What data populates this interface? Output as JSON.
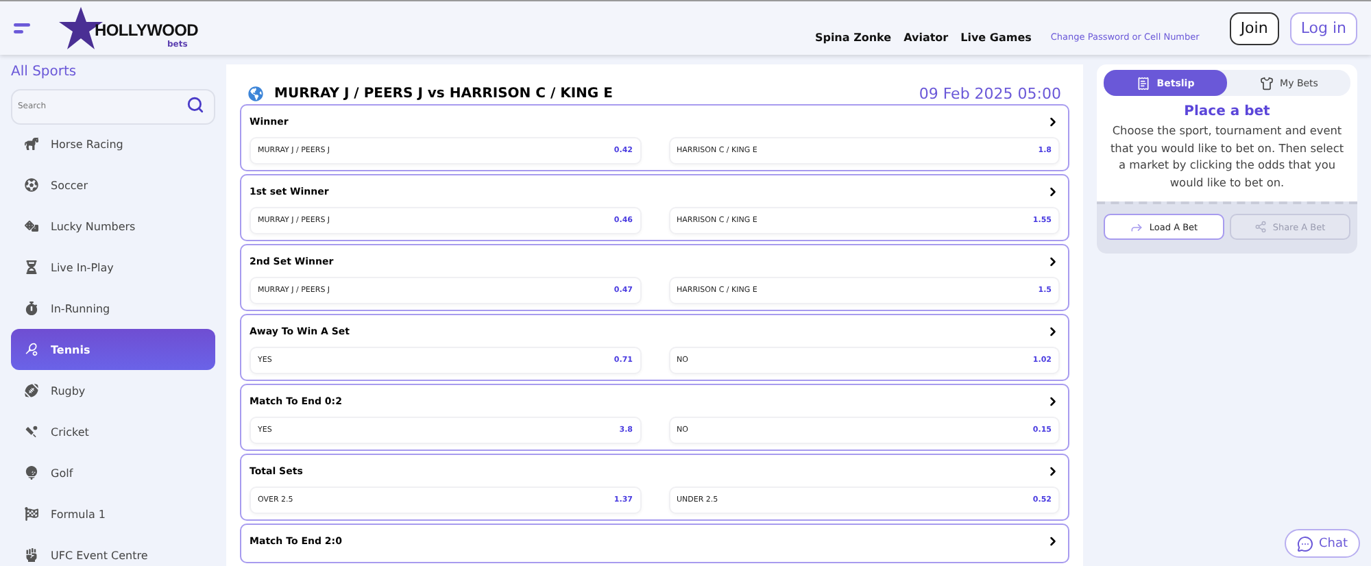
{
  "header": {
    "logo": {
      "name": "HOLLYWOOD",
      "sub": "bets"
    },
    "links": [
      "Spina Zonke",
      "Aviator",
      "Live Games"
    ],
    "account_link": "Change Password or Cell Number",
    "buttons": [
      {
        "label": "Join",
        "kind": "outline-dark"
      },
      {
        "label": "Log in",
        "kind": "outline-accent"
      }
    ]
  },
  "sidebar": {
    "title": "All Sports",
    "search": {
      "placeholder": "Search"
    },
    "items": [
      {
        "label": "Horse Racing",
        "selected": false
      },
      {
        "label": "Soccer",
        "selected": false
      },
      {
        "label": "Lucky Numbers",
        "selected": false
      },
      {
        "label": "Live In-Play",
        "selected": false
      },
      {
        "label": "In-Running",
        "selected": false
      },
      {
        "label": "Tennis",
        "selected": true
      },
      {
        "label": "Rugby",
        "selected": false
      },
      {
        "label": "Cricket",
        "selected": false
      },
      {
        "label": "Golf",
        "selected": false
      },
      {
        "label": "Formula 1",
        "selected": false
      },
      {
        "label": "UFC Event Centre",
        "selected": false
      }
    ]
  },
  "event": {
    "title": "MURRAY J / PEERS J vs HARRISON C / KING E",
    "date": "09 Feb 2025 05:00",
    "markets": [
      {
        "title": "Winner",
        "outcomes": [
          {
            "name": "MURRAY J / PEERS J",
            "odds": "0.42"
          },
          {
            "name": "HARRISON C / KING E",
            "odds": "1.8"
          }
        ]
      },
      {
        "title": "1st set Winner",
        "outcomes": [
          {
            "name": "MURRAY J / PEERS J",
            "odds": "0.46"
          },
          {
            "name": "HARRISON C / KING E",
            "odds": "1.55"
          }
        ]
      },
      {
        "title": "2nd Set Winner",
        "outcomes": [
          {
            "name": "MURRAY J / PEERS J",
            "odds": "0.47"
          },
          {
            "name": "HARRISON C / KING E",
            "odds": "1.5"
          }
        ]
      },
      {
        "title": "Away To Win A Set",
        "outcomes": [
          {
            "name": "YES",
            "odds": "0.71"
          },
          {
            "name": "NO",
            "odds": "1.02"
          }
        ]
      },
      {
        "title": "Match To End 0:2",
        "outcomes": [
          {
            "name": "YES",
            "odds": "3.8"
          },
          {
            "name": "NO",
            "odds": "0.15"
          }
        ]
      },
      {
        "title": "Total Sets",
        "outcomes": [
          {
            "name": "OVER 2.5",
            "odds": "1.37"
          },
          {
            "name": "UNDER 2.5",
            "odds": "0.52"
          }
        ]
      },
      {
        "title": "Match To End 2:0"
      }
    ]
  },
  "betslip": {
    "tabs": [
      {
        "label": "Betslip",
        "selected": true
      },
      {
        "label": "My Bets",
        "selected": false
      }
    ],
    "heading": "Place a bet",
    "text": "Choose the sport, tournament and event that you would like to bet on. Then select a market by clicking the odds that you would like to bet on.",
    "actions": [
      {
        "label": "Load A Bet",
        "disabled": false
      },
      {
        "label": "Share A Bet",
        "disabled": true
      }
    ]
  },
  "chat": {
    "label": "Chat"
  }
}
